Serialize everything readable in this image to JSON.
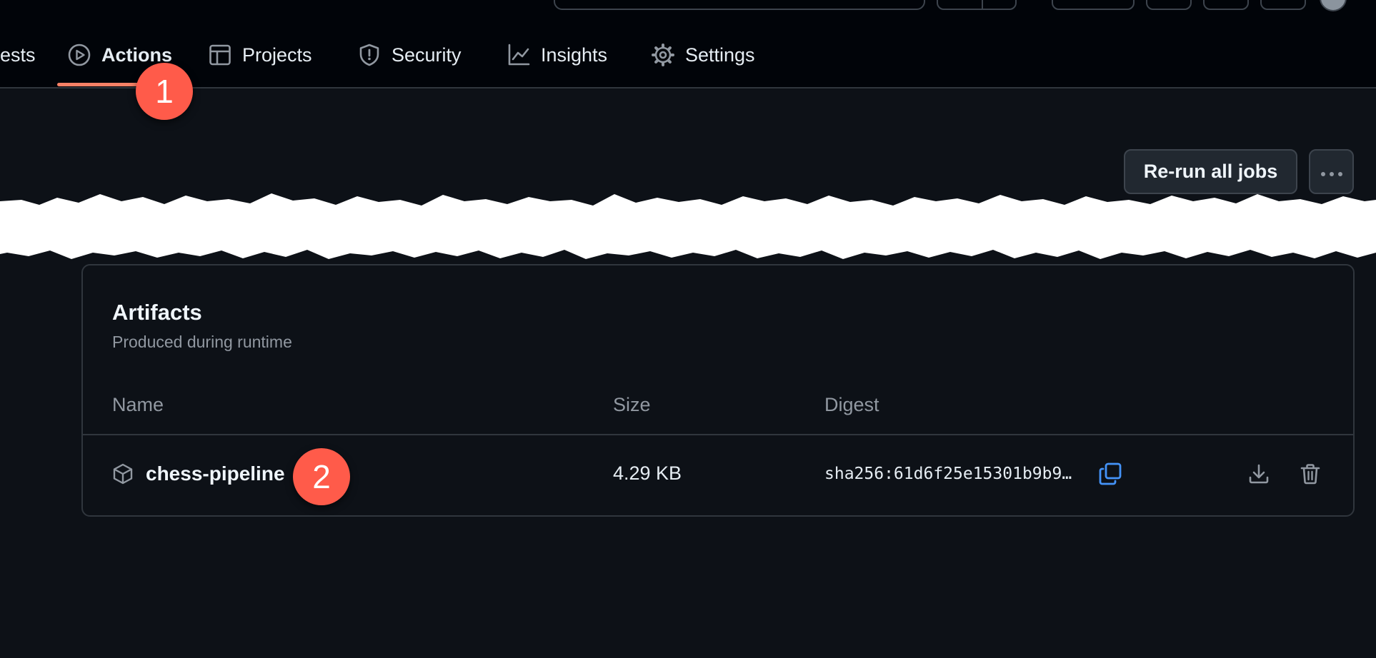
{
  "nav": {
    "tabs": [
      {
        "label": "ests",
        "icon": "pull-request-icon"
      },
      {
        "label": "Actions",
        "icon": "play-icon",
        "active": true
      },
      {
        "label": "Projects",
        "icon": "table-icon"
      },
      {
        "label": "Security",
        "icon": "shield-icon"
      },
      {
        "label": "Insights",
        "icon": "graph-icon"
      },
      {
        "label": "Settings",
        "icon": "gear-icon"
      }
    ]
  },
  "annotations": [
    "1",
    "2"
  ],
  "toolbar": {
    "rerun_label": "Re-run all jobs",
    "more_icon": "kebab-horizontal-icon"
  },
  "artifacts": {
    "title": "Artifacts",
    "subtitle": "Produced during runtime",
    "columns": [
      "Name",
      "Size",
      "Digest"
    ],
    "rows": [
      {
        "name": "chess-pipeline",
        "size": "4.29 KB",
        "digest": "sha256:61d6f25e15301b9b9…",
        "icons": [
          "package-icon",
          "copy-icon",
          "download-icon",
          "trash-icon"
        ]
      }
    ]
  },
  "colors": {
    "background": "#0d1117",
    "header": "#010409",
    "active_tab_underline": "#f78166",
    "annotation_badge": "#ff5b4a",
    "copy_icon": "#4493f8",
    "border": "#30363d"
  }
}
